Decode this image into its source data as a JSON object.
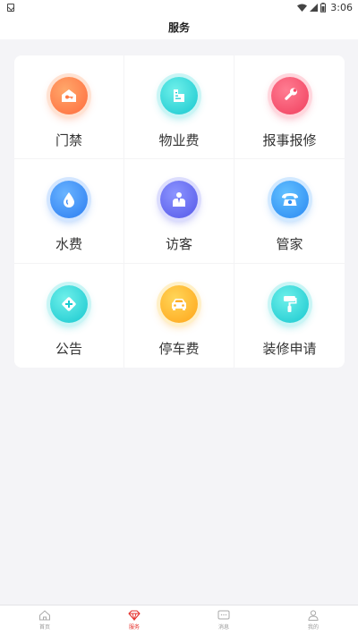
{
  "status_bar": {
    "time": "3:06",
    "icons": [
      "app-notification-icon",
      "wifi-icon",
      "signal-icon",
      "battery-icon"
    ]
  },
  "header": {
    "title": "服务"
  },
  "services": [
    {
      "label": "门禁",
      "icon": "door-key-icon",
      "color": "#ff6b3d"
    },
    {
      "label": "物业费",
      "icon": "property-fee-icon",
      "color": "#17c7cf"
    },
    {
      "label": "报事报修",
      "icon": "wrench-icon",
      "color": "#f03e5d"
    },
    {
      "label": "水费",
      "icon": "water-drop-icon",
      "color": "#2a7cf1"
    },
    {
      "label": "访客",
      "icon": "visitor-icon",
      "color": "#5457e8"
    },
    {
      "label": "管家",
      "icon": "telephone-icon",
      "color": "#2988f2"
    },
    {
      "label": "公告",
      "icon": "announcement-icon",
      "color": "#17c7cf"
    },
    {
      "label": "停车费",
      "icon": "car-icon",
      "color": "#ffa418"
    },
    {
      "label": "装修申请",
      "icon": "paint-roller-icon",
      "color": "#17c7cf"
    }
  ],
  "tab_bar": {
    "active_color": "#e5322d",
    "items": [
      {
        "label": "首页",
        "icon": "home-icon",
        "active": false
      },
      {
        "label": "服务",
        "icon": "diamond-icon",
        "active": true
      },
      {
        "label": "消息",
        "icon": "message-icon",
        "active": false
      },
      {
        "label": "我的",
        "icon": "user-icon",
        "active": false
      }
    ]
  }
}
